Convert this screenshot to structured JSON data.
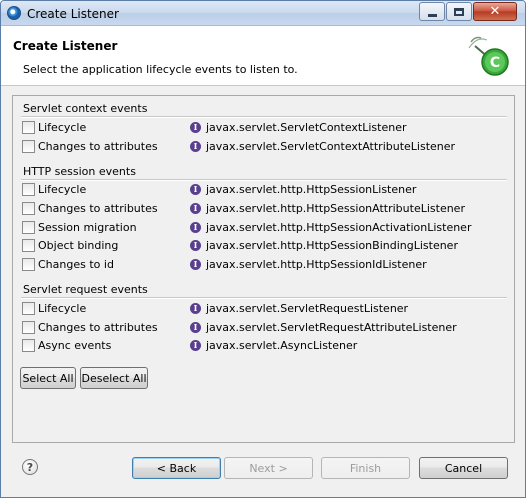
{
  "window": {
    "title": "Create Listener",
    "icon": "eclipse-app-icon"
  },
  "banner": {
    "title": "Create Listener",
    "description": "Select the application lifecycle events to listen to.",
    "icon": "create-listener-wizard-icon"
  },
  "groups": [
    {
      "title": "Servlet context events",
      "items": [
        {
          "label": "Lifecycle",
          "interface": "javax.servlet.ServletContextListener",
          "checked": false
        },
        {
          "label": "Changes to attributes",
          "interface": "javax.servlet.ServletContextAttributeListener",
          "checked": false
        }
      ]
    },
    {
      "title": "HTTP session events",
      "items": [
        {
          "label": "Lifecycle",
          "interface": "javax.servlet.http.HttpSessionListener",
          "checked": false
        },
        {
          "label": "Changes to attributes",
          "interface": "javax.servlet.http.HttpSessionAttributeListener",
          "checked": false
        },
        {
          "label": "Session migration",
          "interface": "javax.servlet.http.HttpSessionActivationListener",
          "checked": false
        },
        {
          "label": "Object binding",
          "interface": "javax.servlet.http.HttpSessionBindingListener",
          "checked": false
        },
        {
          "label": "Changes to id",
          "interface": "javax.servlet.http.HttpSessionIdListener",
          "checked": false
        }
      ]
    },
    {
      "title": "Servlet request events",
      "items": [
        {
          "label": "Lifecycle",
          "interface": "javax.servlet.ServletRequestListener",
          "checked": false
        },
        {
          "label": "Changes to attributes",
          "interface": "javax.servlet.ServletRequestAttributeListener",
          "checked": false
        },
        {
          "label": "Async events",
          "interface": "javax.servlet.AsyncListener",
          "checked": false
        }
      ]
    }
  ],
  "selection_buttons": {
    "select_all": "Select All",
    "deselect_all": "Deselect All"
  },
  "footer": {
    "help": "?",
    "back": "< Back",
    "next": "Next >",
    "finish": "Finish",
    "cancel": "Cancel"
  }
}
